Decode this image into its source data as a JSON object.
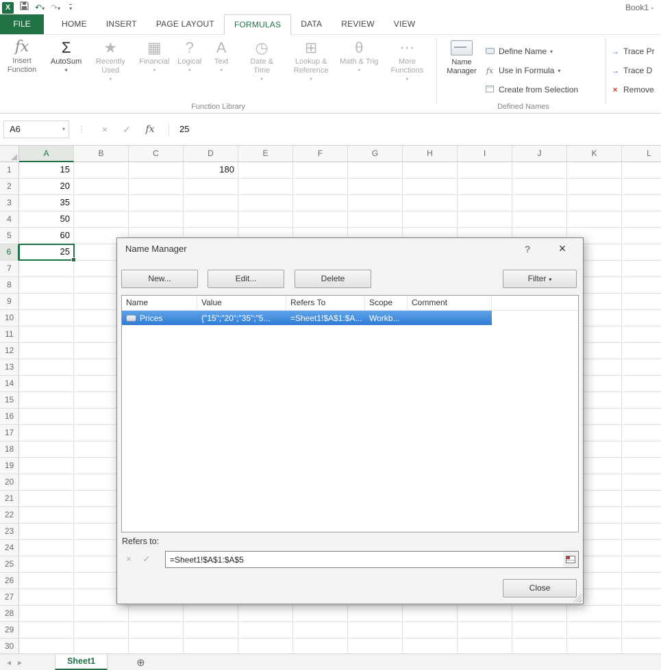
{
  "title_bar": {
    "workbook_title": "Book1 -",
    "logo_letter": "X"
  },
  "icons": {
    "undo": "↶",
    "redo": "↷",
    "caret": "▾",
    "dots": "⋮",
    "cancel": "×",
    "check": "✓",
    "help": "?",
    "close": "×",
    "prev": "◂",
    "next": "▸",
    "new_sheet": "⊕"
  },
  "ribbon_tabs": [
    "FILE",
    "HOME",
    "INSERT",
    "PAGE LAYOUT",
    "FORMULAS",
    "DATA",
    "REVIEW",
    "VIEW"
  ],
  "active_tab": "FORMULAS",
  "function_library": {
    "group_label": "Function Library",
    "insert_function_label": "Insert Function",
    "insert_function_icon": "fx",
    "buttons": [
      {
        "label": "AutoSum",
        "icon": "Σ",
        "enabled": true
      },
      {
        "label": "Recently Used",
        "icon": "★",
        "enabled": false
      },
      {
        "label": "Financial",
        "icon": "▦",
        "enabled": false
      },
      {
        "label": "Logical",
        "icon": "?",
        "enabled": false
      },
      {
        "label": "Text",
        "icon": "A",
        "enabled": false
      },
      {
        "label": "Date & Time",
        "icon": "◷",
        "enabled": false
      },
      {
        "label": "Lookup & Reference",
        "icon": "⊞",
        "enabled": false
      },
      {
        "label": "Math & Trig",
        "icon": "θ",
        "enabled": false
      },
      {
        "label": "More Functions",
        "icon": "⋯",
        "enabled": false
      }
    ]
  },
  "defined_names": {
    "group_label": "Defined Names",
    "name_manager_label": "Name Manager",
    "items": [
      {
        "label": "Define Name",
        "icon": "tag",
        "dropdown": true
      },
      {
        "label": "Use in Formula",
        "icon": "fx",
        "dropdown": true
      },
      {
        "label": "Create from Selection",
        "icon": "grid",
        "dropdown": false
      }
    ]
  },
  "formula_auditing": {
    "items": [
      {
        "label": "Trace Pr",
        "icon": "→",
        "color": "blue"
      },
      {
        "label": "Trace D",
        "icon": "→",
        "color": "blue"
      },
      {
        "label": "Remove",
        "icon": "×",
        "color": "red"
      }
    ]
  },
  "formula_bar": {
    "name_box": "A6",
    "formula": "25",
    "fx_icon": "fx"
  },
  "grid": {
    "columns": [
      "A",
      "B",
      "C",
      "D",
      "E",
      "F",
      "G",
      "H",
      "I",
      "J",
      "K",
      "L"
    ],
    "row_count": 30,
    "selected": {
      "col": "A",
      "row": 6
    },
    "cells": {
      "A1": "15",
      "A2": "20",
      "A3": "35",
      "A4": "50",
      "A5": "60",
      "A6": "25",
      "D1": "180"
    }
  },
  "dialog": {
    "title": "Name Manager",
    "buttons": {
      "new": "New...",
      "edit": "Edit...",
      "delete": "Delete",
      "filter": "Filter"
    },
    "columns": [
      "Name",
      "Value",
      "Refers To",
      "Scope",
      "Comment"
    ],
    "rows": [
      {
        "name": "Prices",
        "value": "{\"15\";\"20\";\"35\";\"5...",
        "refers_to": "=Sheet1!$A$1:$A...",
        "scope": "Workb...",
        "comment": ""
      }
    ],
    "refers_to_label": "Refers to:",
    "refers_to_value": "=Sheet1!$A$1:$A$5",
    "close_button": "Close"
  },
  "sheet_bar": {
    "active_tab": "Sheet1"
  }
}
